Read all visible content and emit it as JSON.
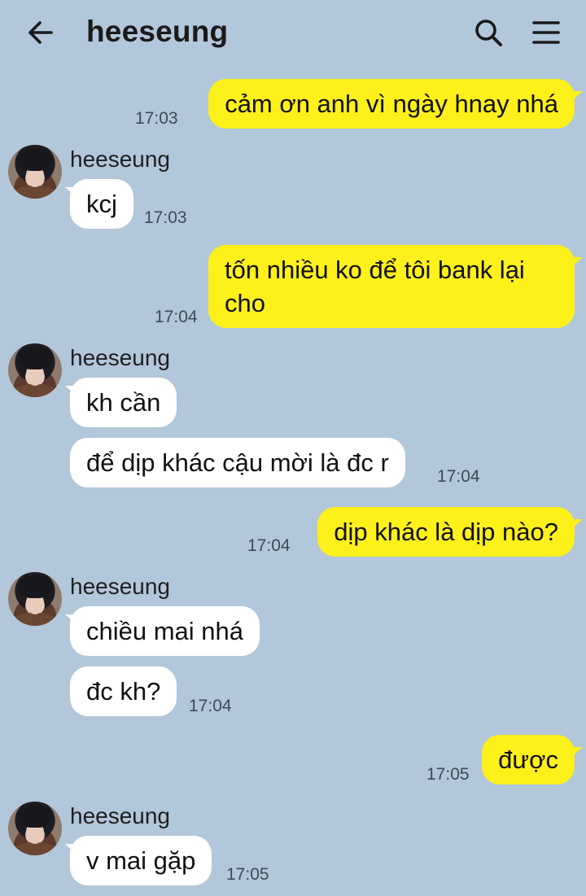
{
  "header": {
    "title": "heeseung",
    "back_icon": "arrow-left-icon",
    "search_icon": "search-icon",
    "menu_icon": "hamburger-menu-icon"
  },
  "colors": {
    "background": "#b2c7d9",
    "my_bubble": "#fef01b",
    "their_bubble": "#ffffff"
  },
  "messages": [
    {
      "sender": "me",
      "text": "cảm ơn anh vì ngày hnay nhá",
      "time": "17:03"
    },
    {
      "sender": "heeseung",
      "name": "heeseung",
      "text": "kcj",
      "time": "17:03"
    },
    {
      "sender": "me",
      "text": "tốn nhiều ko để tôi bank lại cho",
      "time": "17:04"
    },
    {
      "sender": "heeseung",
      "name": "heeseung",
      "text": "kh cần"
    },
    {
      "sender": "heeseung",
      "text": "để dịp khác cậu mời là đc r",
      "time": "17:04"
    },
    {
      "sender": "me",
      "text": "dịp khác là dịp nào?",
      "time": "17:04"
    },
    {
      "sender": "heeseung",
      "name": "heeseung",
      "text": "chiều mai nhá"
    },
    {
      "sender": "heeseung",
      "text": "đc kh?",
      "time": "17:04"
    },
    {
      "sender": "me",
      "text": "được",
      "time": "17:05"
    },
    {
      "sender": "heeseung",
      "name": "heeseung",
      "text": "v mai gặp",
      "time": "17:05"
    }
  ]
}
